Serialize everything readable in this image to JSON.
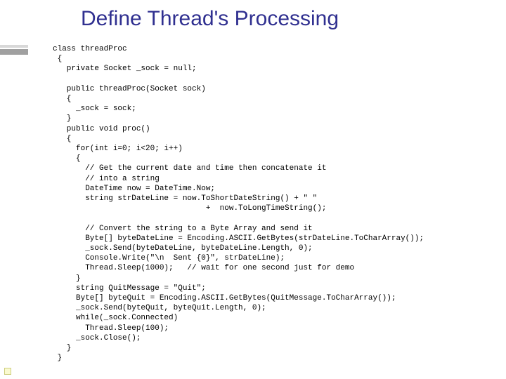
{
  "title": "Define Thread's Processing",
  "code": "class threadProc\n {\n   private Socket _sock = null;\n\n   public threadProc(Socket sock)\n   {\n     _sock = sock;\n   }\n   public void proc()\n   {\n     for(int i=0; i<20; i++)\n     {\n       // Get the current date and time then concatenate it\n       // into a string\n       DateTime now = DateTime.Now;\n       string strDateLine = now.ToShortDateString() + \" \"\n                                 +  now.ToLongTimeString();\n\n       // Convert the string to a Byte Array and send it\n       Byte[] byteDateLine = Encoding.ASCII.GetBytes(strDateLine.ToCharArray());\n       _sock.Send(byteDateLine, byteDateLine.Length, 0);\n       Console.Write(\"\\n  Sent {0}\", strDateLine);\n       Thread.Sleep(1000);   // wait for one second just for demo\n     }\n     string QuitMessage = \"Quit\";\n     Byte[] byteQuit = Encoding.ASCII.GetBytes(QuitMessage.ToCharArray());\n     _sock.Send(byteQuit, byteQuit.Length, 0);\n     while(_sock.Connected)\n       Thread.Sleep(100);\n     _sock.Close();\n   }\n }"
}
